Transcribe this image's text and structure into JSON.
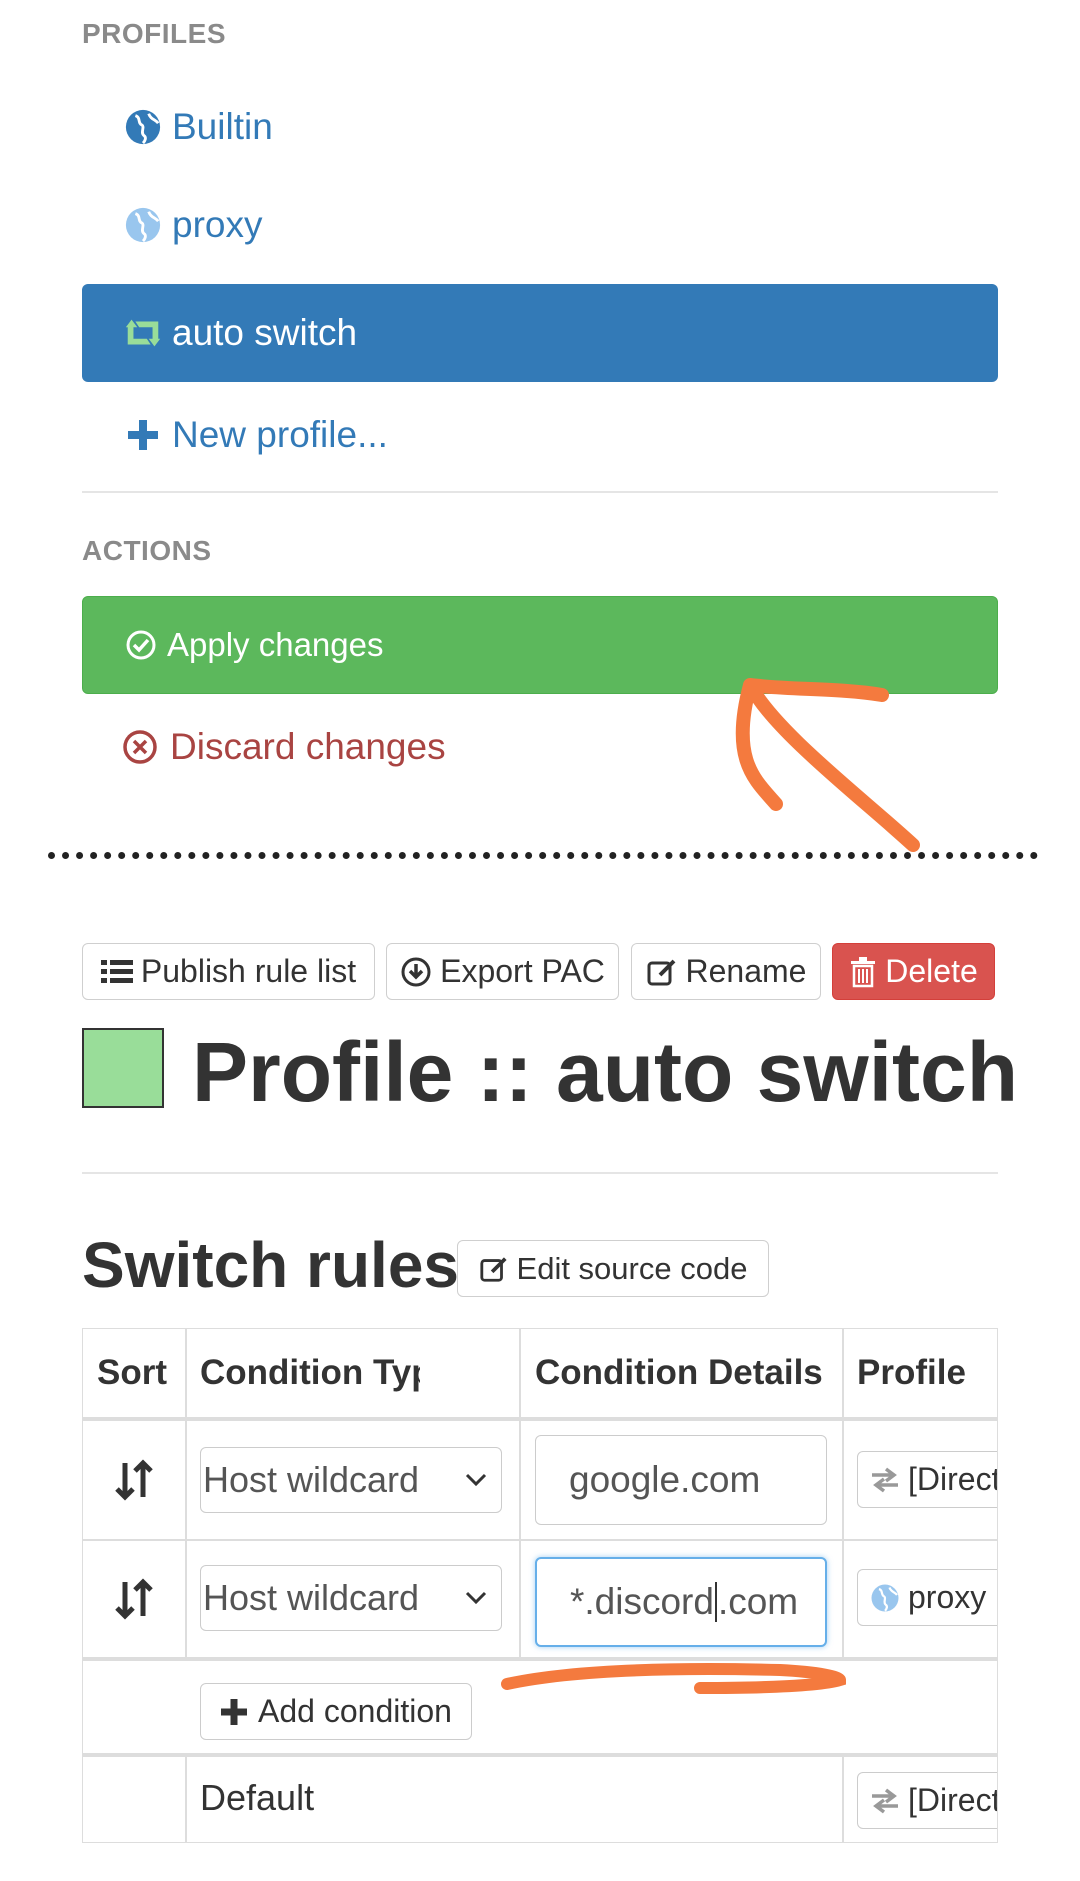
{
  "profiles_section": {
    "title": "PROFILES",
    "items": [
      {
        "label": "Builtin",
        "icon": "globe-icon"
      },
      {
        "label": "proxy",
        "icon": "globe-icon"
      },
      {
        "label": "auto switch",
        "icon": "retweet-icon",
        "active": true
      },
      {
        "label": "New profile...",
        "icon": "plus-icon"
      }
    ]
  },
  "actions_section": {
    "title": "ACTIONS",
    "apply_label": "Apply changes",
    "discard_label": "Discard changes"
  },
  "toolbar": {
    "publish_label": "Publish rule list",
    "export_label": "Export PAC",
    "rename_label": "Rename",
    "delete_label": "Delete"
  },
  "page": {
    "title": "Profile :: auto switch",
    "profile_color": "#99dd99"
  },
  "switch_rules": {
    "title": "Switch rules",
    "edit_source_label": "Edit source code",
    "columns": [
      "Sort",
      "Condition Type",
      "Condition Details",
      "Profile"
    ],
    "rows": [
      {
        "condition_type": "Host wildcard",
        "condition_details": "google.com",
        "profile": "[Direct]"
      },
      {
        "condition_type": "Host wildcard",
        "condition_details_before_caret": "*.discord",
        "condition_details_after_caret": ".com",
        "profile": "proxy"
      }
    ],
    "add_condition_label": "Add condition",
    "default_label": "Default",
    "default_profile": "[Direct]"
  },
  "colors": {
    "primary": "#337ab7",
    "success": "#5cb85c",
    "danger_button": "#d9534f",
    "danger_text": "#a94442",
    "annotation": "#f47a3e"
  }
}
